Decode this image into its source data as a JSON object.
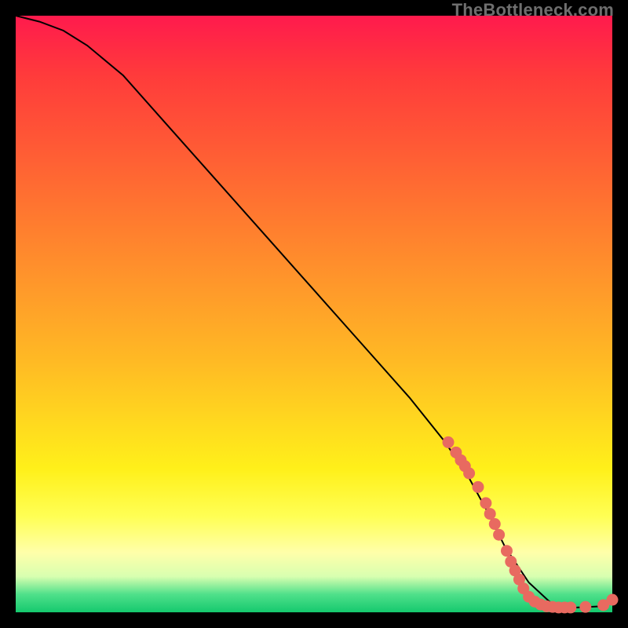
{
  "watermark": "TheBottleneck.com",
  "chart_data": {
    "type": "line",
    "title": "",
    "xlabel": "",
    "ylabel": "",
    "xlim": [
      0,
      100
    ],
    "ylim": [
      0,
      100
    ],
    "grid": false,
    "series": [
      {
        "name": "curve",
        "x": [
          0,
          4,
          8,
          12,
          18,
          26,
          34,
          42,
          50,
          58,
          66,
          72,
          76,
          79,
          82,
          86,
          90,
          94,
          98,
          100
        ],
        "y": [
          100,
          99,
          97.5,
          95,
          90,
          81,
          72,
          63,
          54,
          45,
          36,
          28.5,
          22.5,
          17,
          11,
          5,
          1.3,
          0.8,
          1.0,
          2.2
        ],
        "color": "#000000",
        "width": 2
      }
    ],
    "markers": {
      "name": "dots",
      "color": "#e86a60",
      "radius": 7.5,
      "points": [
        {
          "x": 72.5,
          "y": 28.5
        },
        {
          "x": 73.8,
          "y": 26.8
        },
        {
          "x": 74.6,
          "y": 25.5
        },
        {
          "x": 75.3,
          "y": 24.5
        },
        {
          "x": 76.0,
          "y": 23.3
        },
        {
          "x": 77.5,
          "y": 21.0
        },
        {
          "x": 78.8,
          "y": 18.3
        },
        {
          "x": 79.5,
          "y": 16.5
        },
        {
          "x": 80.3,
          "y": 14.8
        },
        {
          "x": 81.0,
          "y": 13.0
        },
        {
          "x": 82.3,
          "y": 10.3
        },
        {
          "x": 83.0,
          "y": 8.5
        },
        {
          "x": 83.7,
          "y": 7.0
        },
        {
          "x": 84.4,
          "y": 5.5
        },
        {
          "x": 85.1,
          "y": 4.0
        },
        {
          "x": 86.0,
          "y": 2.6
        },
        {
          "x": 87.0,
          "y": 1.8
        },
        {
          "x": 88.0,
          "y": 1.3
        },
        {
          "x": 89.0,
          "y": 1.0
        },
        {
          "x": 90.0,
          "y": 0.9
        },
        {
          "x": 91.0,
          "y": 0.8
        },
        {
          "x": 92.0,
          "y": 0.8
        },
        {
          "x": 93.0,
          "y": 0.8
        },
        {
          "x": 95.5,
          "y": 0.9
        },
        {
          "x": 98.5,
          "y": 1.2
        },
        {
          "x": 100.0,
          "y": 2.1
        }
      ]
    }
  }
}
